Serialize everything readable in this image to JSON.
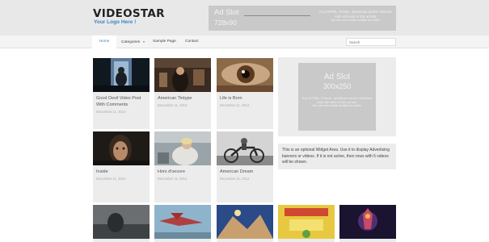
{
  "site": {
    "logo": "VIDEOSTAR",
    "tagline": "Your Logo Here !"
  },
  "header_ad": {
    "title": "Ad Slot",
    "size": "728x90",
    "info": "Any XHTML, iFrame, JavaScript and/or AdSense code will work in this ad slot.",
    "note": "You can even rotate multiple ad codes."
  },
  "nav": {
    "items": [
      "Home",
      "Categories",
      "Sample Page",
      "Contact"
    ],
    "active": "Home",
    "search_placeholder": "Search"
  },
  "posts": [
    {
      "title": "Good Devil Video Post With Comments",
      "date": "December 11, 2012"
    },
    {
      "title": "American Tintype",
      "date": "December 11, 2012"
    },
    {
      "title": "Life is Born",
      "date": "December 11, 2012"
    },
    {
      "title": "Inside",
      "date": "December 11, 2012"
    },
    {
      "title": "Hors d'oeuvre",
      "date": "December 11, 2012"
    },
    {
      "title": "American Dream",
      "date": "December 11, 2012"
    }
  ],
  "sidebar_ad": {
    "title": "Ad Slot",
    "size": "300x250",
    "info": "Any XHTML, iFrame, JavaScript and/or AdSense code will work in this ad slot.",
    "note": "You can even rotate multiple ad codes."
  },
  "widget": {
    "text": "This is an optional Widget Area. Use it to display Advertising banners or videos. If it is not active, then rows with 5 videos will be shown."
  },
  "colors": {
    "accent": "#3a86c8",
    "header_bg": "#e8e8e8",
    "card_bg": "#ececec",
    "ad_bg": "#c9c9c9"
  }
}
